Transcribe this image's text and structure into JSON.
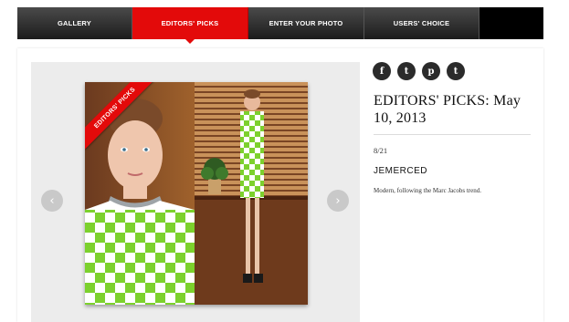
{
  "nav": {
    "items": [
      {
        "label": "GALLERY",
        "active": false
      },
      {
        "label": "EDITORS' PICKS",
        "active": true
      },
      {
        "label": "ENTER YOUR PHOTO",
        "active": false
      },
      {
        "label": "USERS' CHOICE",
        "active": false
      }
    ]
  },
  "colors": {
    "accent": "#e30a0a",
    "nav_bg": "#2a2a2a",
    "viewer_bg": "#ececec"
  },
  "viewer": {
    "prev_icon": "chevron-left-icon",
    "next_icon": "chevron-right-icon",
    "prev_glyph": "‹",
    "next_glyph": "›",
    "ribbon_label": "EDITORS' PICKS"
  },
  "social": [
    {
      "name": "facebook-icon",
      "glyph": "f"
    },
    {
      "name": "twitter-icon",
      "glyph": "t"
    },
    {
      "name": "pinterest-icon",
      "glyph": "p"
    },
    {
      "name": "tumblr-icon",
      "glyph": "t"
    }
  ],
  "detail": {
    "title": "EDITORS' PICKS: May 10, 2013",
    "count": "8/21",
    "username": "JEMERCED",
    "caption": "Modern, following the Marc Jacobs trend."
  }
}
